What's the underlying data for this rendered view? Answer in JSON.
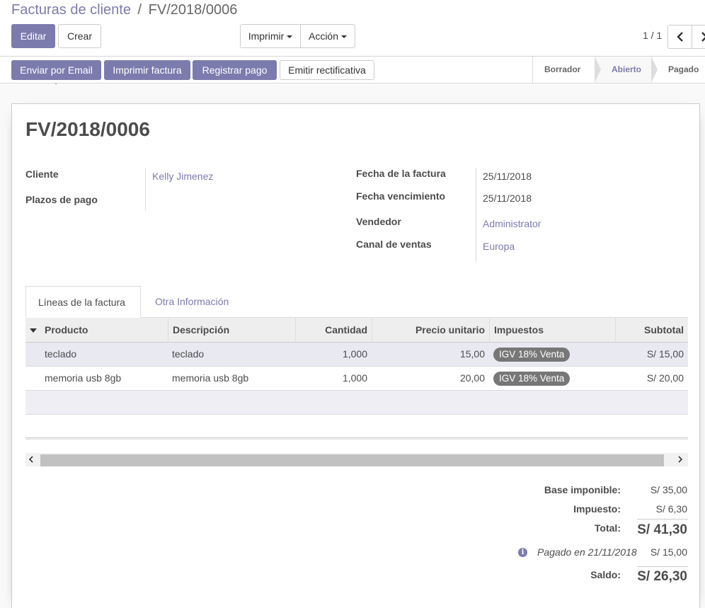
{
  "breadcrumb": {
    "parent": "Facturas de cliente",
    "separator": "/",
    "current": "FV/2018/0006"
  },
  "toolbar": {
    "edit_label": "Editar",
    "create_label": "Crear",
    "print_label": "Imprimir",
    "action_label": "Acción"
  },
  "pager": {
    "value": "1 / 1",
    "prev_icon": "chevron-left-icon",
    "next_icon": "chevron-right-icon"
  },
  "statusbar": {
    "buttons": {
      "send_email": "Enviar por Email",
      "print_invoice": "Imprimir factura",
      "register_payment": "Registrar pago",
      "credit_note": "Emitir rectificativa"
    },
    "stages": [
      "Borrador",
      "Abierto",
      "Pagado"
    ],
    "active_stage": "Abierto"
  },
  "invoice": {
    "number": "FV/2018/0006",
    "fields_left": {
      "customer_label": "Cliente",
      "customer_value": "Kelly Jimenez",
      "payment_terms_label": "Plazos de pago",
      "payment_terms_value": ""
    },
    "fields_right": {
      "invoice_date_label": "Fecha de la factura",
      "invoice_date_value": "25/11/2018",
      "due_date_label": "Fecha vencimiento",
      "due_date_value": "25/11/2018",
      "salesperson_label": "Vendedor",
      "salesperson_value": "Administrator",
      "sales_channel_label": "Canal de ventas",
      "sales_channel_value": "Europa"
    }
  },
  "tabs": [
    {
      "label": "Líneas de la factura",
      "active": true
    },
    {
      "label": "Otra Información",
      "active": false
    }
  ],
  "lines_table": {
    "columns": [
      "Producto",
      "Descripción",
      "Cantidad",
      "Precio unitario",
      "Impuestos",
      "Subtotal"
    ],
    "rows": [
      {
        "product": "teclado",
        "description": "teclado",
        "quantity": "1,000",
        "unit_price": "15,00",
        "tax": "IGV 18% Venta",
        "subtotal": "S/ 15,00"
      },
      {
        "product": "memoria usb 8gb",
        "description": "memoria usb 8gb",
        "quantity": "1,000",
        "unit_price": "20,00",
        "tax": "IGV 18% Venta",
        "subtotal": "S/ 20,00"
      }
    ]
  },
  "totals": {
    "base_label": "Base imponible:",
    "base_value": "S/ 35,00",
    "tax_label": "Impuesto:",
    "tax_value": "S/ 6,30",
    "total_label": "Total:",
    "total_value": "S/ 41,30",
    "paid_note": "Pagado en 21/11/2018",
    "paid_value": "S/ 15,00",
    "balance_label": "Saldo:",
    "balance_value": "S/ 26,30"
  },
  "colors": {
    "accent": "#7c7bad",
    "badge": "#777777",
    "selected_row": "#e9e9f2"
  }
}
